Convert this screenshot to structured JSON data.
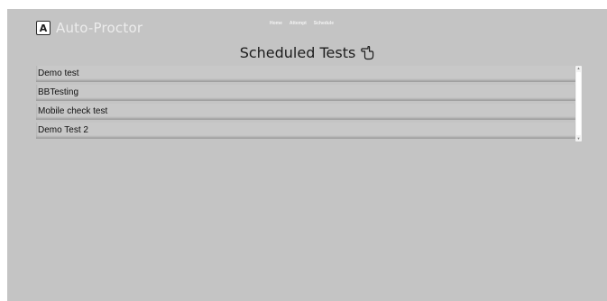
{
  "header": {
    "brand_logo_letter": "A",
    "brand_name": "Auto-Proctor",
    "nav": [
      "Home",
      "Attempt",
      "Schedule"
    ]
  },
  "page": {
    "title": "Scheduled Tests",
    "title_icon": "pointer-hand-icon"
  },
  "tests": [
    "Demo test",
    "BBTesting",
    "Mobile check test",
    "Demo Test 2"
  ],
  "colors": {
    "background": "#c4c4c4",
    "brand_text": "#ececec",
    "title_text": "#1c1c1c"
  }
}
